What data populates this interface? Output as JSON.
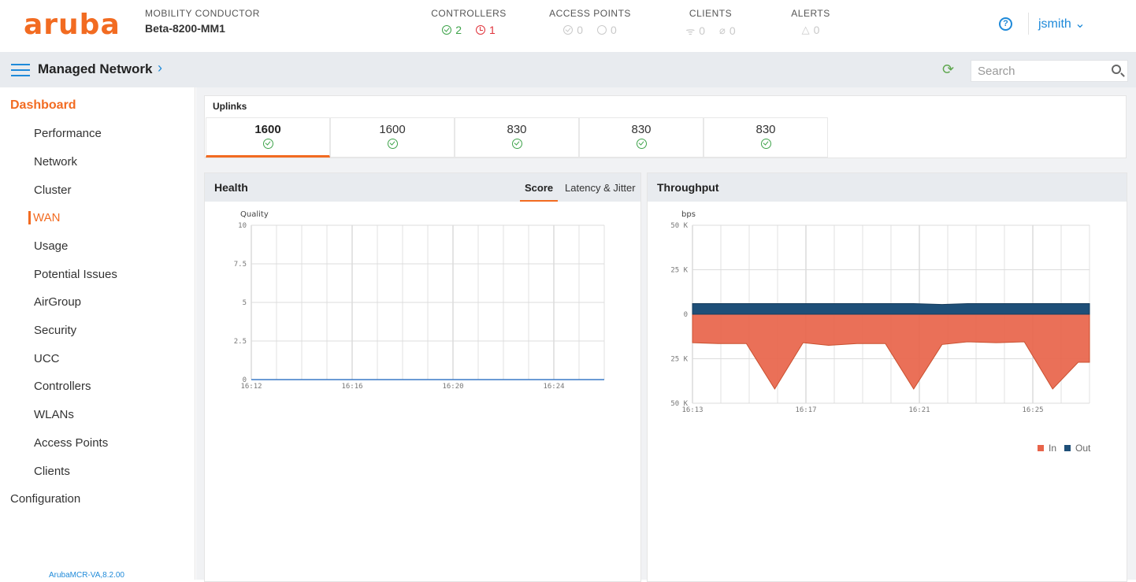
{
  "header": {
    "logo": "aruba",
    "conductor_label": "MOBILITY CONDUCTOR",
    "conductor_name": "Beta-8200-MM1",
    "stats": [
      {
        "label": "CONTROLLERS",
        "values": [
          "2",
          "1"
        ]
      },
      {
        "label": "ACCESS POINTS",
        "values": [
          "0",
          "0"
        ]
      },
      {
        "label": "CLIENTS",
        "values": [
          "0",
          "0"
        ]
      },
      {
        "label": "ALERTS",
        "values": [
          "0"
        ]
      }
    ],
    "help_glyph": "?",
    "user": "jsmith ⌄"
  },
  "nav": {
    "title": "Managed Network",
    "chevron": "›",
    "refresh_glyph": "⟳",
    "search_placeholder": "Search"
  },
  "sidebar": {
    "heading": "Dashboard",
    "items": [
      "Performance",
      "Network",
      "Cluster",
      "WAN",
      "Usage",
      "Potential Issues",
      "AirGroup",
      "Security",
      "UCC",
      "Controllers",
      "WLANs",
      "Access Points",
      "Clients"
    ],
    "active_item": "WAN",
    "config": "Configuration",
    "version": "ArubaMCR-VA,8.2.00"
  },
  "uplinks": {
    "title": "Uplinks",
    "tiles": [
      "1600",
      "1600",
      "830",
      "830",
      "830"
    ],
    "selected_index": 0
  },
  "health": {
    "title": "Health",
    "tabs": [
      "Score",
      "Latency & Jitter"
    ],
    "active_tab": "Score"
  },
  "throughput": {
    "title": "Throughput"
  },
  "colors": {
    "accent": "#f26b21",
    "link": "#1f8ad9",
    "ok": "#3ea34a",
    "error": "#e0333b",
    "series_in": "#e8644a",
    "series_out": "#1e4f78"
  },
  "chart_data": [
    {
      "type": "line",
      "title": "",
      "ylabel": "Quality",
      "x": [
        "16:12",
        "16:16",
        "16:20",
        "16:24"
      ],
      "yticks": [
        "10",
        "7.5",
        "5",
        "2.5",
        "0"
      ],
      "ylim": [
        0,
        10
      ],
      "series": [
        {
          "values": [
            0,
            0,
            0,
            0,
            0
          ]
        }
      ],
      "grid": true
    },
    {
      "type": "area",
      "title": "",
      "ylabel": "bps",
      "x": [
        "16:13",
        "16:17",
        "16:21",
        "16:25"
      ],
      "yticks": [
        "50 K",
        "25 K",
        "0",
        "25 K",
        "50 K"
      ],
      "ylim": [
        -50000,
        50000
      ],
      "samples_x_minutes": [
        0,
        0.9,
        1.9,
        2.9,
        3.9,
        4.8,
        5.8,
        6.8,
        7.8,
        8.8,
        9.7,
        10.7,
        11.7,
        12.7,
        13.6,
        14.0
      ],
      "series": [
        {
          "name": "In",
          "values": [
            -16000,
            -16500,
            -16500,
            -42000,
            -16000,
            -17500,
            -16500,
            -16500,
            -42000,
            -17000,
            -15500,
            -16000,
            -15500,
            -42000,
            -27000,
            -27000
          ]
        },
        {
          "name": "Out",
          "values": [
            6000,
            6000,
            6000,
            6000,
            6000,
            6000,
            6000,
            6000,
            6000,
            5500,
            6000,
            6000,
            6000,
            6000,
            6000,
            6000
          ]
        }
      ],
      "legend": "bottom-right",
      "grid": true
    }
  ]
}
